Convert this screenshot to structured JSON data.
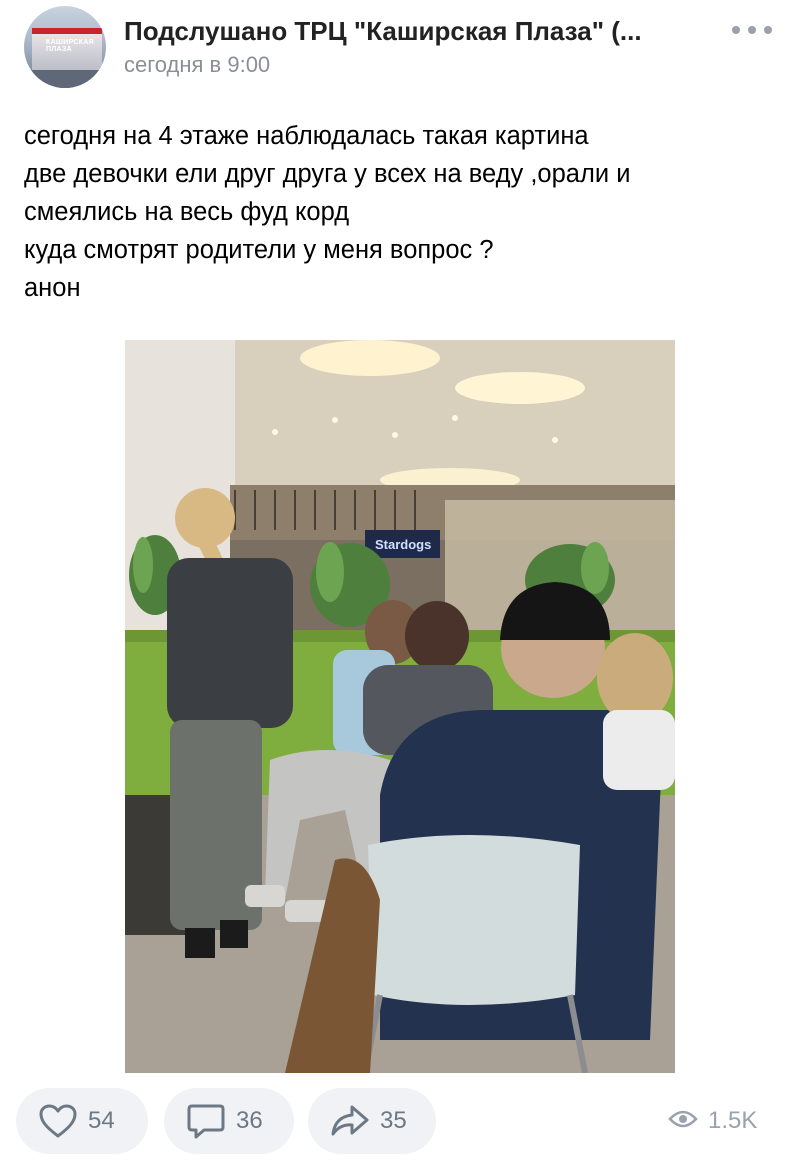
{
  "header": {
    "group_name": "Подслушано ТРЦ \"Каширская Плаза\" (...",
    "time": "сегодня в 9:00",
    "avatar_sign": "КАШИРСКАЯ ПЛАЗА"
  },
  "post": {
    "lines": [
      "сегодня на 4 этаже наблюдалась такая картина",
      "две девочки ели друг друга у всех на веду ,орали и",
      "смеялись на весь фуд корд",
      "куда смотрят родители у меня вопрос ?",
      "анон"
    ],
    "photo_sign": "Stardogs"
  },
  "footer": {
    "likes": "54",
    "comments": "36",
    "shares": "35",
    "views": "1.5K"
  },
  "icons": {
    "like": "heart-icon",
    "comment": "comment-icon",
    "share": "share-icon",
    "views": "eye-icon",
    "more": "more-dots-icon"
  },
  "colors": {
    "icon_gray": "#6d7885",
    "pill_bg": "#f0f2f5",
    "meta_text": "#8a8f97"
  }
}
